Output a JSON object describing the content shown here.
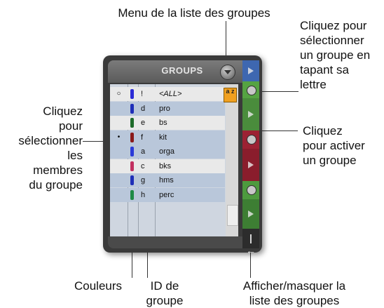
{
  "annotations": {
    "menu": "Menu de la liste des groupes",
    "select_by_letter": [
      "Cliquez pour",
      "sélectionner",
      "un groupe en",
      "tapant sa",
      "lettre"
    ],
    "select_members": [
      "Cliquez",
      "pour",
      "sélectionner",
      "les",
      "membres",
      "du groupe"
    ],
    "activate": [
      "Cliquez",
      "pour activer",
      "un groupe"
    ],
    "colors": "Couleurs",
    "group_id": [
      "ID de",
      "groupe"
    ],
    "show_hide": [
      "Afficher/masquer la",
      "liste des groupes"
    ]
  },
  "panel": {
    "title": "GROUPS",
    "rows": [
      {
        "id": "!",
        "name": "<ALL>",
        "color": "#2b2bd6",
        "bg": "#e9e9e9",
        "marker": "○"
      },
      {
        "id": "d",
        "name": "pro",
        "color": "#1f2fb8",
        "bg": "#b9c7da",
        "marker": ""
      },
      {
        "id": "e",
        "name": "bs",
        "color": "#1e6b2a",
        "bg": "#e9e9e9",
        "marker": ""
      },
      {
        "id": "f",
        "name": "kit",
        "color": "#8a1a1a",
        "bg": "#b9c7da",
        "marker": "•"
      },
      {
        "id": "a",
        "name": "orga",
        "color": "#2a3ad8",
        "bg": "#b9c7da",
        "marker": ""
      },
      {
        "id": "c",
        "name": "bks",
        "color": "#c23060",
        "bg": "#e9e9e9",
        "marker": ""
      },
      {
        "id": "g",
        "name": "hms",
        "color": "#1f2fb8",
        "bg": "#b9c7da",
        "marker": ""
      },
      {
        "id": "h",
        "name": "perc",
        "color": "#1e8a46",
        "bg": "#b9c7da",
        "marker": ""
      }
    ],
    "select_badge": "a z",
    "toggle_symbol": "|←"
  }
}
